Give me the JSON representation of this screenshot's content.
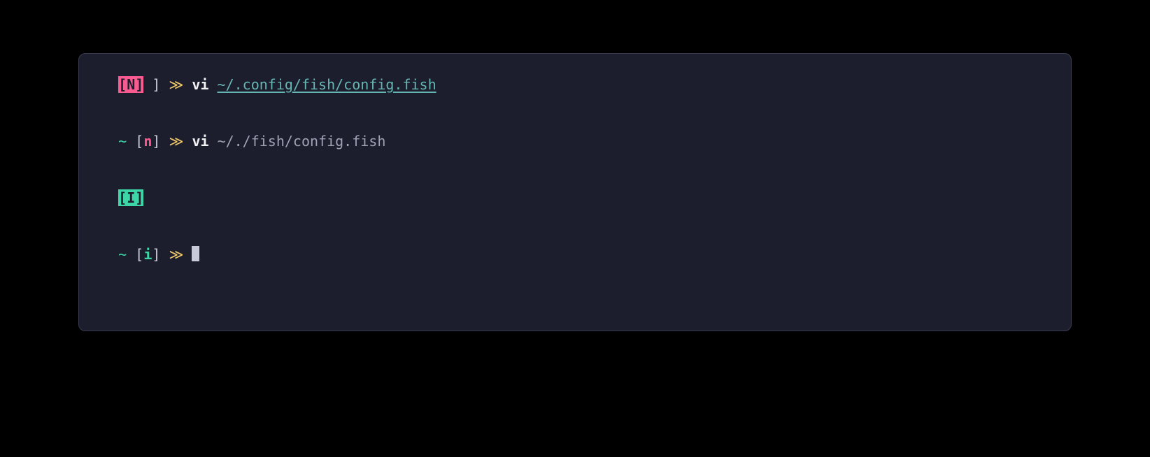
{
  "lines": {
    "l1": {
      "mode_box": "[N]",
      "after_box_space": " ",
      "bracket_close": "]",
      "arrow": " ≫ ",
      "cmd": "vi ",
      "path": "~/.config/fish/config.fish"
    },
    "l2": {
      "tilde": "~ ",
      "bracket_open": "[",
      "mode_letter": "n",
      "bracket_close": "]",
      "arrow": " ≫ ",
      "cmd": "vi ",
      "path": "~/./fish/config.fish"
    },
    "l3": {
      "mode_box": "[I]"
    },
    "l4": {
      "tilde": "~ ",
      "bracket_open": "[",
      "mode_letter": "i",
      "bracket_close": "]",
      "arrow": " ≫ "
    }
  },
  "colors": {
    "bg": "#1d1e2d",
    "border": "#393a4d",
    "pink": "#f95a8f",
    "green": "#3dd6a6",
    "yellow": "#eec76a",
    "teal": "#65b6b3",
    "gray": "#c8cbd7"
  }
}
